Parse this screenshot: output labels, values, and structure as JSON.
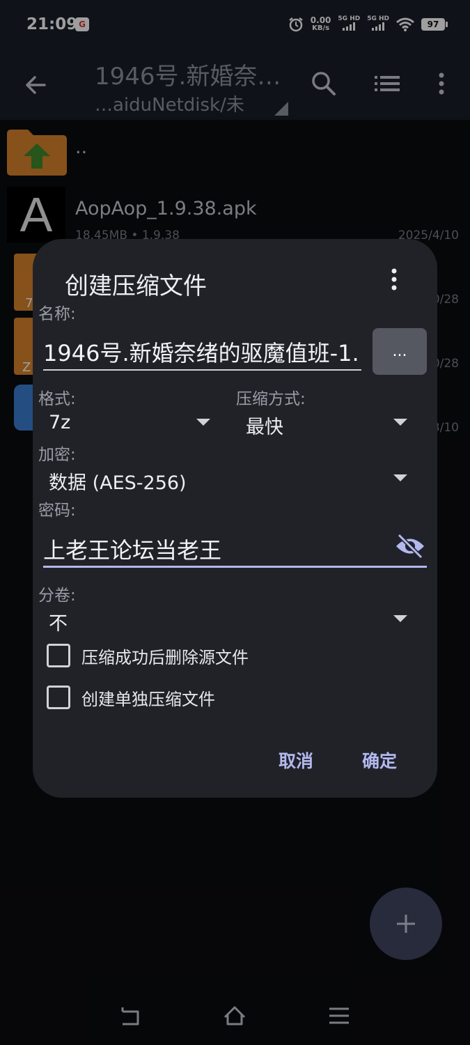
{
  "status_bar": {
    "time": "21:09",
    "app_badge": "G",
    "net_speed_value": "0.00",
    "net_speed_unit": "KB/s",
    "sim1": "5G HD",
    "sim2": "5G HD",
    "battery": "97"
  },
  "app_bar": {
    "title": "1946号.新婚奈…",
    "subtitle": "…aiduNetdisk/未",
    "icons": [
      "back-arrow-icon",
      "search-icon",
      "list-view-icon",
      "more-vert-icon"
    ]
  },
  "file_list": [
    {
      "name": "..",
      "icon": "folder-up-icon"
    },
    {
      "name": "AopAop_1.9.38.apk",
      "meta": "18.45MB  • 1.9.38",
      "date": "2025/4/10",
      "icon": "apk-icon"
    },
    {
      "name": "",
      "date": "0/28",
      "icon": "archive-7z-icon",
      "badge": "7"
    },
    {
      "name": "",
      "date": "0/28",
      "icon": "archive-zip-icon",
      "badge": "Z"
    },
    {
      "name": "",
      "date": "3/10",
      "icon": "app-icon"
    }
  ],
  "dialog": {
    "title": "创建压缩文件",
    "name_label": "名称:",
    "name_value": "1946号.新婚奈绪的驱魔值班-1.",
    "browse_label": "...",
    "format_label": "格式:",
    "format_value": "7z",
    "method_label": "压缩方式:",
    "method_value": "最快",
    "encryption_label": "加密:",
    "encryption_value": "数据 (AES-256)",
    "password_label": "密码:",
    "password_value": "上老王论坛当老王",
    "split_label": "分卷:",
    "split_value": "不",
    "checkbox_delete": "压缩成功后删除源文件",
    "checkbox_separate": "创建单独压缩文件",
    "cancel": "取消",
    "ok": "确定",
    "accent_color": "#b3b8ee"
  },
  "fab": {
    "icon": "plus-icon"
  },
  "nav_bar": {
    "icons": [
      "nav-back-icon",
      "nav-home-icon",
      "nav-menu-icon"
    ]
  }
}
